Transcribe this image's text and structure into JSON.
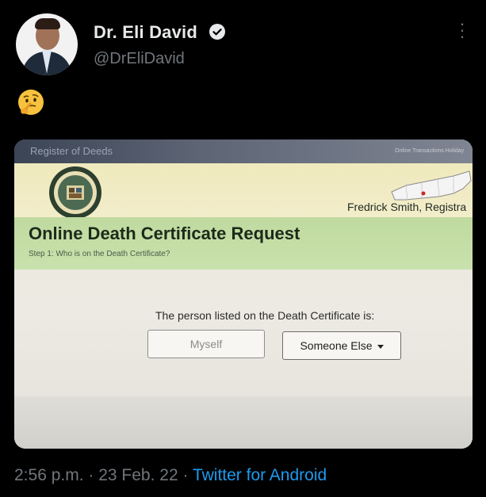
{
  "author": {
    "name": "Dr. Eli David",
    "handle": "@DrEliDavid"
  },
  "tweet": {
    "emoji": "thinking-face"
  },
  "media_screen": {
    "top_bar_text": "Register of Deeds",
    "top_bar_right": "Online Transactions  Holiday",
    "registrar": "Fredrick Smith, Registra",
    "title": "Online Death Certificate Request",
    "step": "Step 1: Who is on the Death Certificate?",
    "prompt": "The person listed on the Death Certificate is:",
    "button_myself": "Myself",
    "button_someone_else": "Someone Else"
  },
  "meta": {
    "time": "2:56 p.m.",
    "separator": " · ",
    "date": "23 Feb. 22",
    "source": "Twitter for Android"
  },
  "colors": {
    "background": "#000000",
    "link": "#1d9bf0",
    "secondary_text": "#71767b",
    "title_band": "#c9e1ad"
  }
}
